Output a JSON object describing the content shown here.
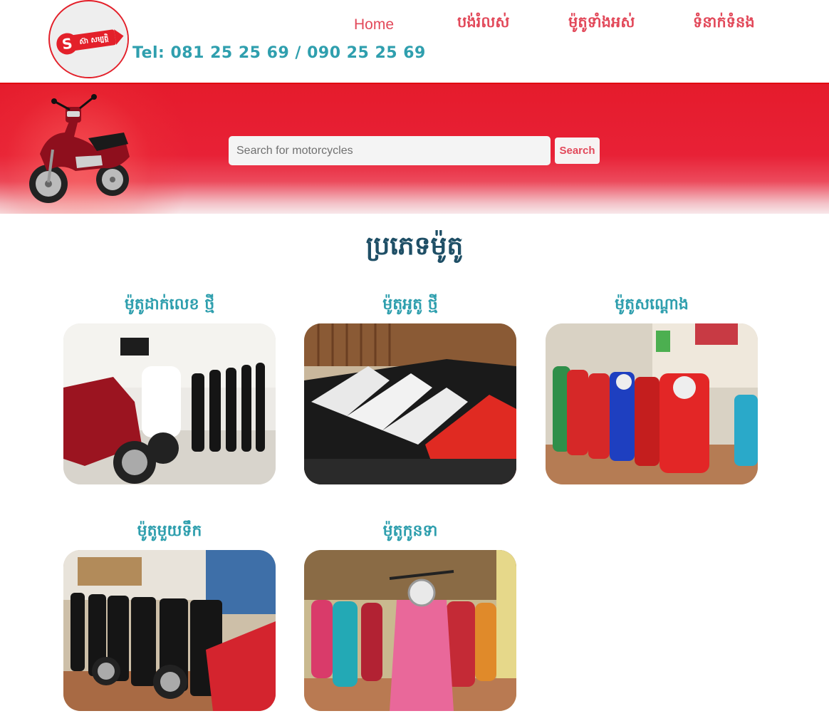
{
  "header": {
    "logo_text": "ស៊ា សម្បត្តិ",
    "phone": "Tel: 081 25 25 69 / 090 25 25 69",
    "nav": {
      "home": "Home",
      "second_hand": "បង់រំលស់",
      "all_motos": "ម៉ូតូទាំងអស់",
      "contact": "ទំនាក់ទំនង"
    }
  },
  "search": {
    "placeholder": "Search for motorcycles",
    "value": "",
    "button_label": "Search"
  },
  "section": {
    "title": "ប្រភេទម៉ូតូ"
  },
  "categories": [
    {
      "label": "ម៉ូតូដាក់លេខ ថ្មី"
    },
    {
      "label": "ម៉ូតូអូតូ ថ្មី"
    },
    {
      "label": "ម៉ូតូសណ្តោង"
    },
    {
      "label": "ម៉ូតូមួយទឹក"
    },
    {
      "label": "ម៉ូតូកូនទា"
    }
  ],
  "colors": {
    "brand_red": "#e3202a",
    "nav_pink": "#e2495a",
    "teal": "#2f9fae",
    "title_navy": "#1f4f66"
  }
}
